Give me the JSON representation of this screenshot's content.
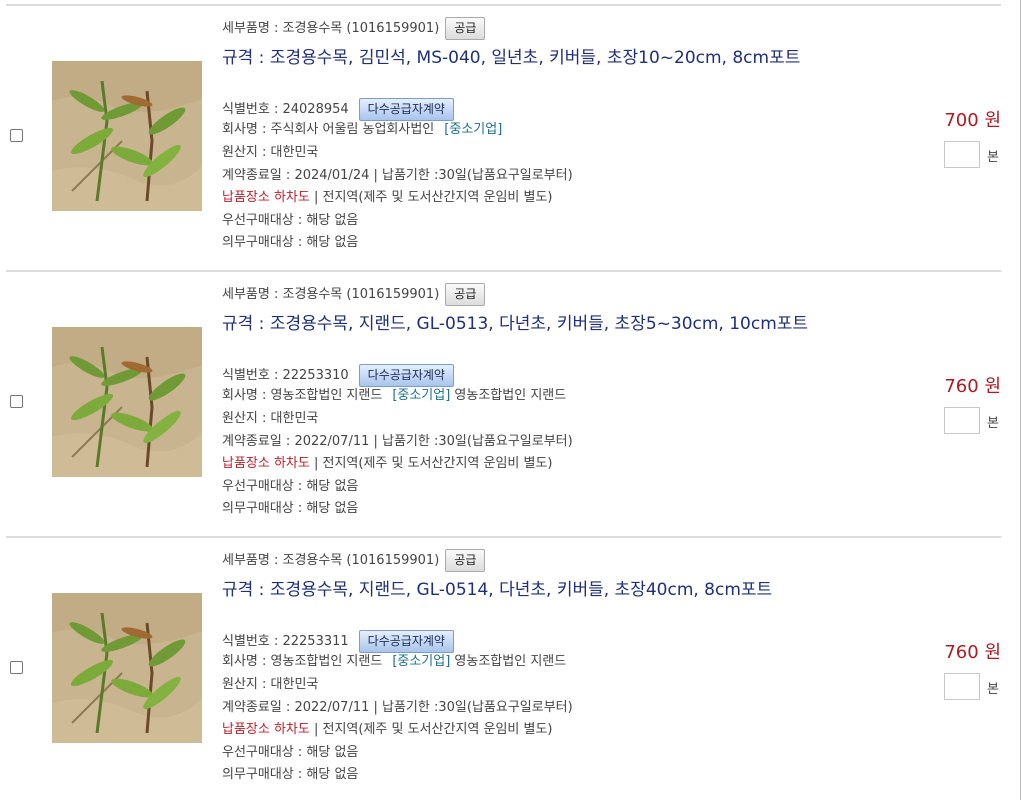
{
  "items": [
    {
      "detail_label": "세부품명 : 조경용수목 (1016159901)",
      "supply_button": "공급",
      "spec_text": "규격 : 조경용수목, 김민석, MS-040, 일년초, 키버들, 초장10~20cm, 8cm포트",
      "ident_label": "식별번호 : 24028954",
      "contract_button": "다수공급자계약",
      "company_label": "회사명 : 주식회사 어울림 농업회사법인",
      "sme_tag": "[중소기업]",
      "company_extra": "",
      "origin_label": "원산지 : 대한민국",
      "contract_info": "계약종료일 : 2024/01/24 | 납품기한 :30일(납품요구일로부터)",
      "delivery_place": "납품장소 하차도",
      "delivery_region": " | 전지역(제주 및 도서산간지역 운임비 별도)",
      "preferred_purchase": "우선구매대상 : 해당 없음",
      "mandatory_purchase": "의무구매대상 : 해당 없음",
      "price": "700 원",
      "quantity_value": "",
      "unit": "본"
    },
    {
      "detail_label": "세부품명 : 조경용수목 (1016159901)",
      "supply_button": "공급",
      "spec_text": "규격 : 조경용수목, 지랜드, GL-0513, 다년초, 키버들, 초장5~30cm, 10cm포트",
      "ident_label": "식별번호 : 22253310",
      "contract_button": "다수공급자계약",
      "company_label": "회사명 : 영농조합법인 지랜드",
      "sme_tag": "[중소기업]",
      "company_extra": " 영농조합법인 지랜드",
      "origin_label": "원산지 : 대한민국",
      "contract_info": "계약종료일 : 2022/07/11 | 납품기한 :30일(납품요구일로부터)",
      "delivery_place": "납품장소 하차도",
      "delivery_region": " | 전지역(제주 및 도서산간지역 운임비 별도)",
      "preferred_purchase": "우선구매대상 : 해당 없음",
      "mandatory_purchase": "의무구매대상 : 해당 없음",
      "price": "760 원",
      "quantity_value": "",
      "unit": "본"
    },
    {
      "detail_label": "세부품명 : 조경용수목 (1016159901)",
      "supply_button": "공급",
      "spec_text": "규격 : 조경용수목, 지랜드, GL-0514, 다년초, 키버들, 초장40cm, 8cm포트",
      "ident_label": "식별번호 : 22253311",
      "contract_button": "다수공급자계약",
      "company_label": "회사명 : 영농조합법인 지랜드",
      "sme_tag": "[중소기업]",
      "company_extra": " 영농조합법인 지랜드",
      "origin_label": "원산지 : 대한민국",
      "contract_info": "계약종료일 : 2022/07/11 | 납품기한 :30일(납품요구일로부터)",
      "delivery_place": "납품장소 하차도",
      "delivery_region": " | 전지역(제주 및 도서산간지역 운임비 별도)",
      "preferred_purchase": "우선구매대상 : 해당 없음",
      "mandatory_purchase": "의무구매대상 : 해당 없음",
      "price": "760 원",
      "quantity_value": "",
      "unit": "본"
    }
  ],
  "colors": {
    "spec_text": "#1f2f7a",
    "price": "#b01a22",
    "delivery_place": "#c0202a",
    "sme_tag": "#1c6e8c"
  }
}
